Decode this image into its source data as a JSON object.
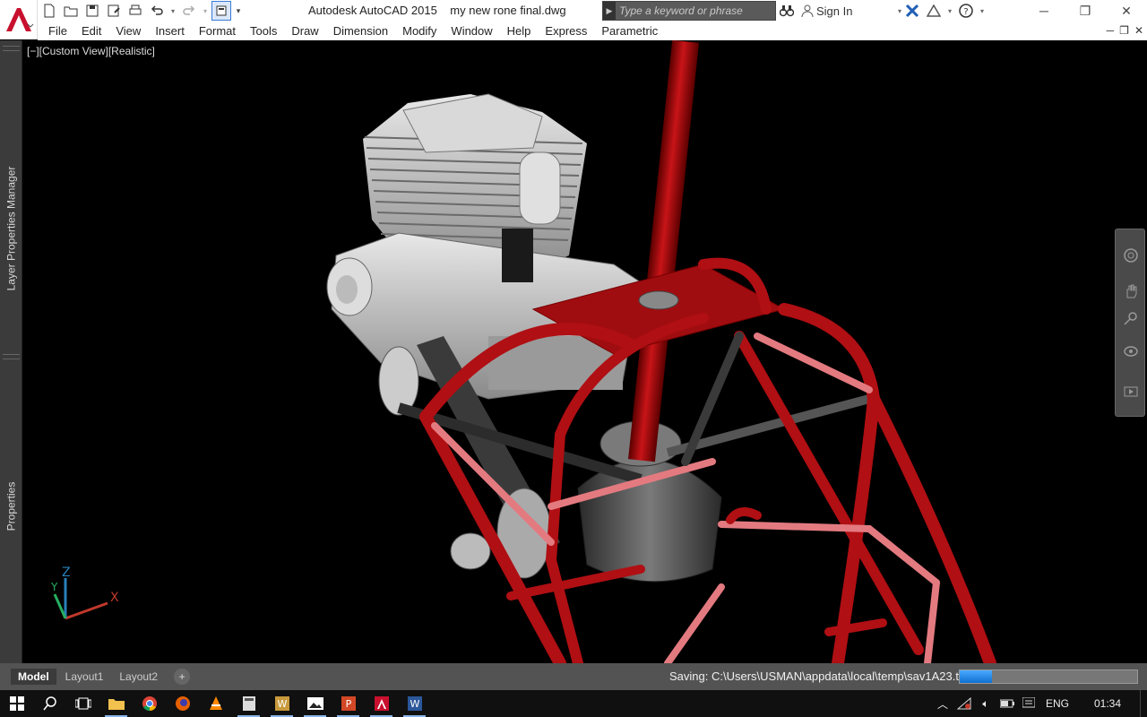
{
  "titlebar": {
    "app_title": "Autodesk AutoCAD 2015",
    "file_name": "my new rone final.dwg",
    "search_placeholder": "Type a keyword or phrase",
    "sign_in": "Sign In"
  },
  "menu": [
    "File",
    "Edit",
    "View",
    "Insert",
    "Format",
    "Tools",
    "Draw",
    "Dimension",
    "Modify",
    "Window",
    "Help",
    "Express",
    "Parametric"
  ],
  "viewport": {
    "label": "[−][Custom View][Realistic]",
    "ucs": {
      "x": "X",
      "y": "Y",
      "z": "Z"
    }
  },
  "palettes": {
    "layer_manager": "Layer Properties Manager",
    "properties": "Properties"
  },
  "layout_tabs": [
    "Model",
    "Layout1",
    "Layout2"
  ],
  "add_tab": "+",
  "status": {
    "saving_text": "Saving: C:\\Users\\USMAN\\appdata\\local\\temp\\sav1A23.tmp",
    "progress": 0.18
  },
  "taskbar": {
    "language": "ENG",
    "time": "01:34"
  },
  "colors": {
    "frame_red": "#9e0c10",
    "engine_gray": "#c8c8c8",
    "accent_blue": "#1070d0"
  }
}
